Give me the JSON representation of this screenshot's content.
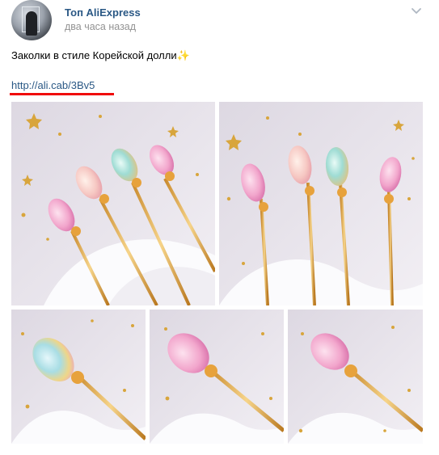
{
  "post": {
    "author": "Топ AliExpress",
    "time": "два часа назад",
    "text": "Заколки в стиле Корейской долли",
    "text_emoji": "✨",
    "link": "http://ali.cab/3Bv5",
    "photo_count": 5
  },
  "icons": {
    "menu": "chevron-down-icon",
    "avatar": "user-avatar"
  },
  "colors": {
    "link": "#2a5885",
    "meta": "#939393",
    "annotation_underline": "#f00a0a"
  }
}
